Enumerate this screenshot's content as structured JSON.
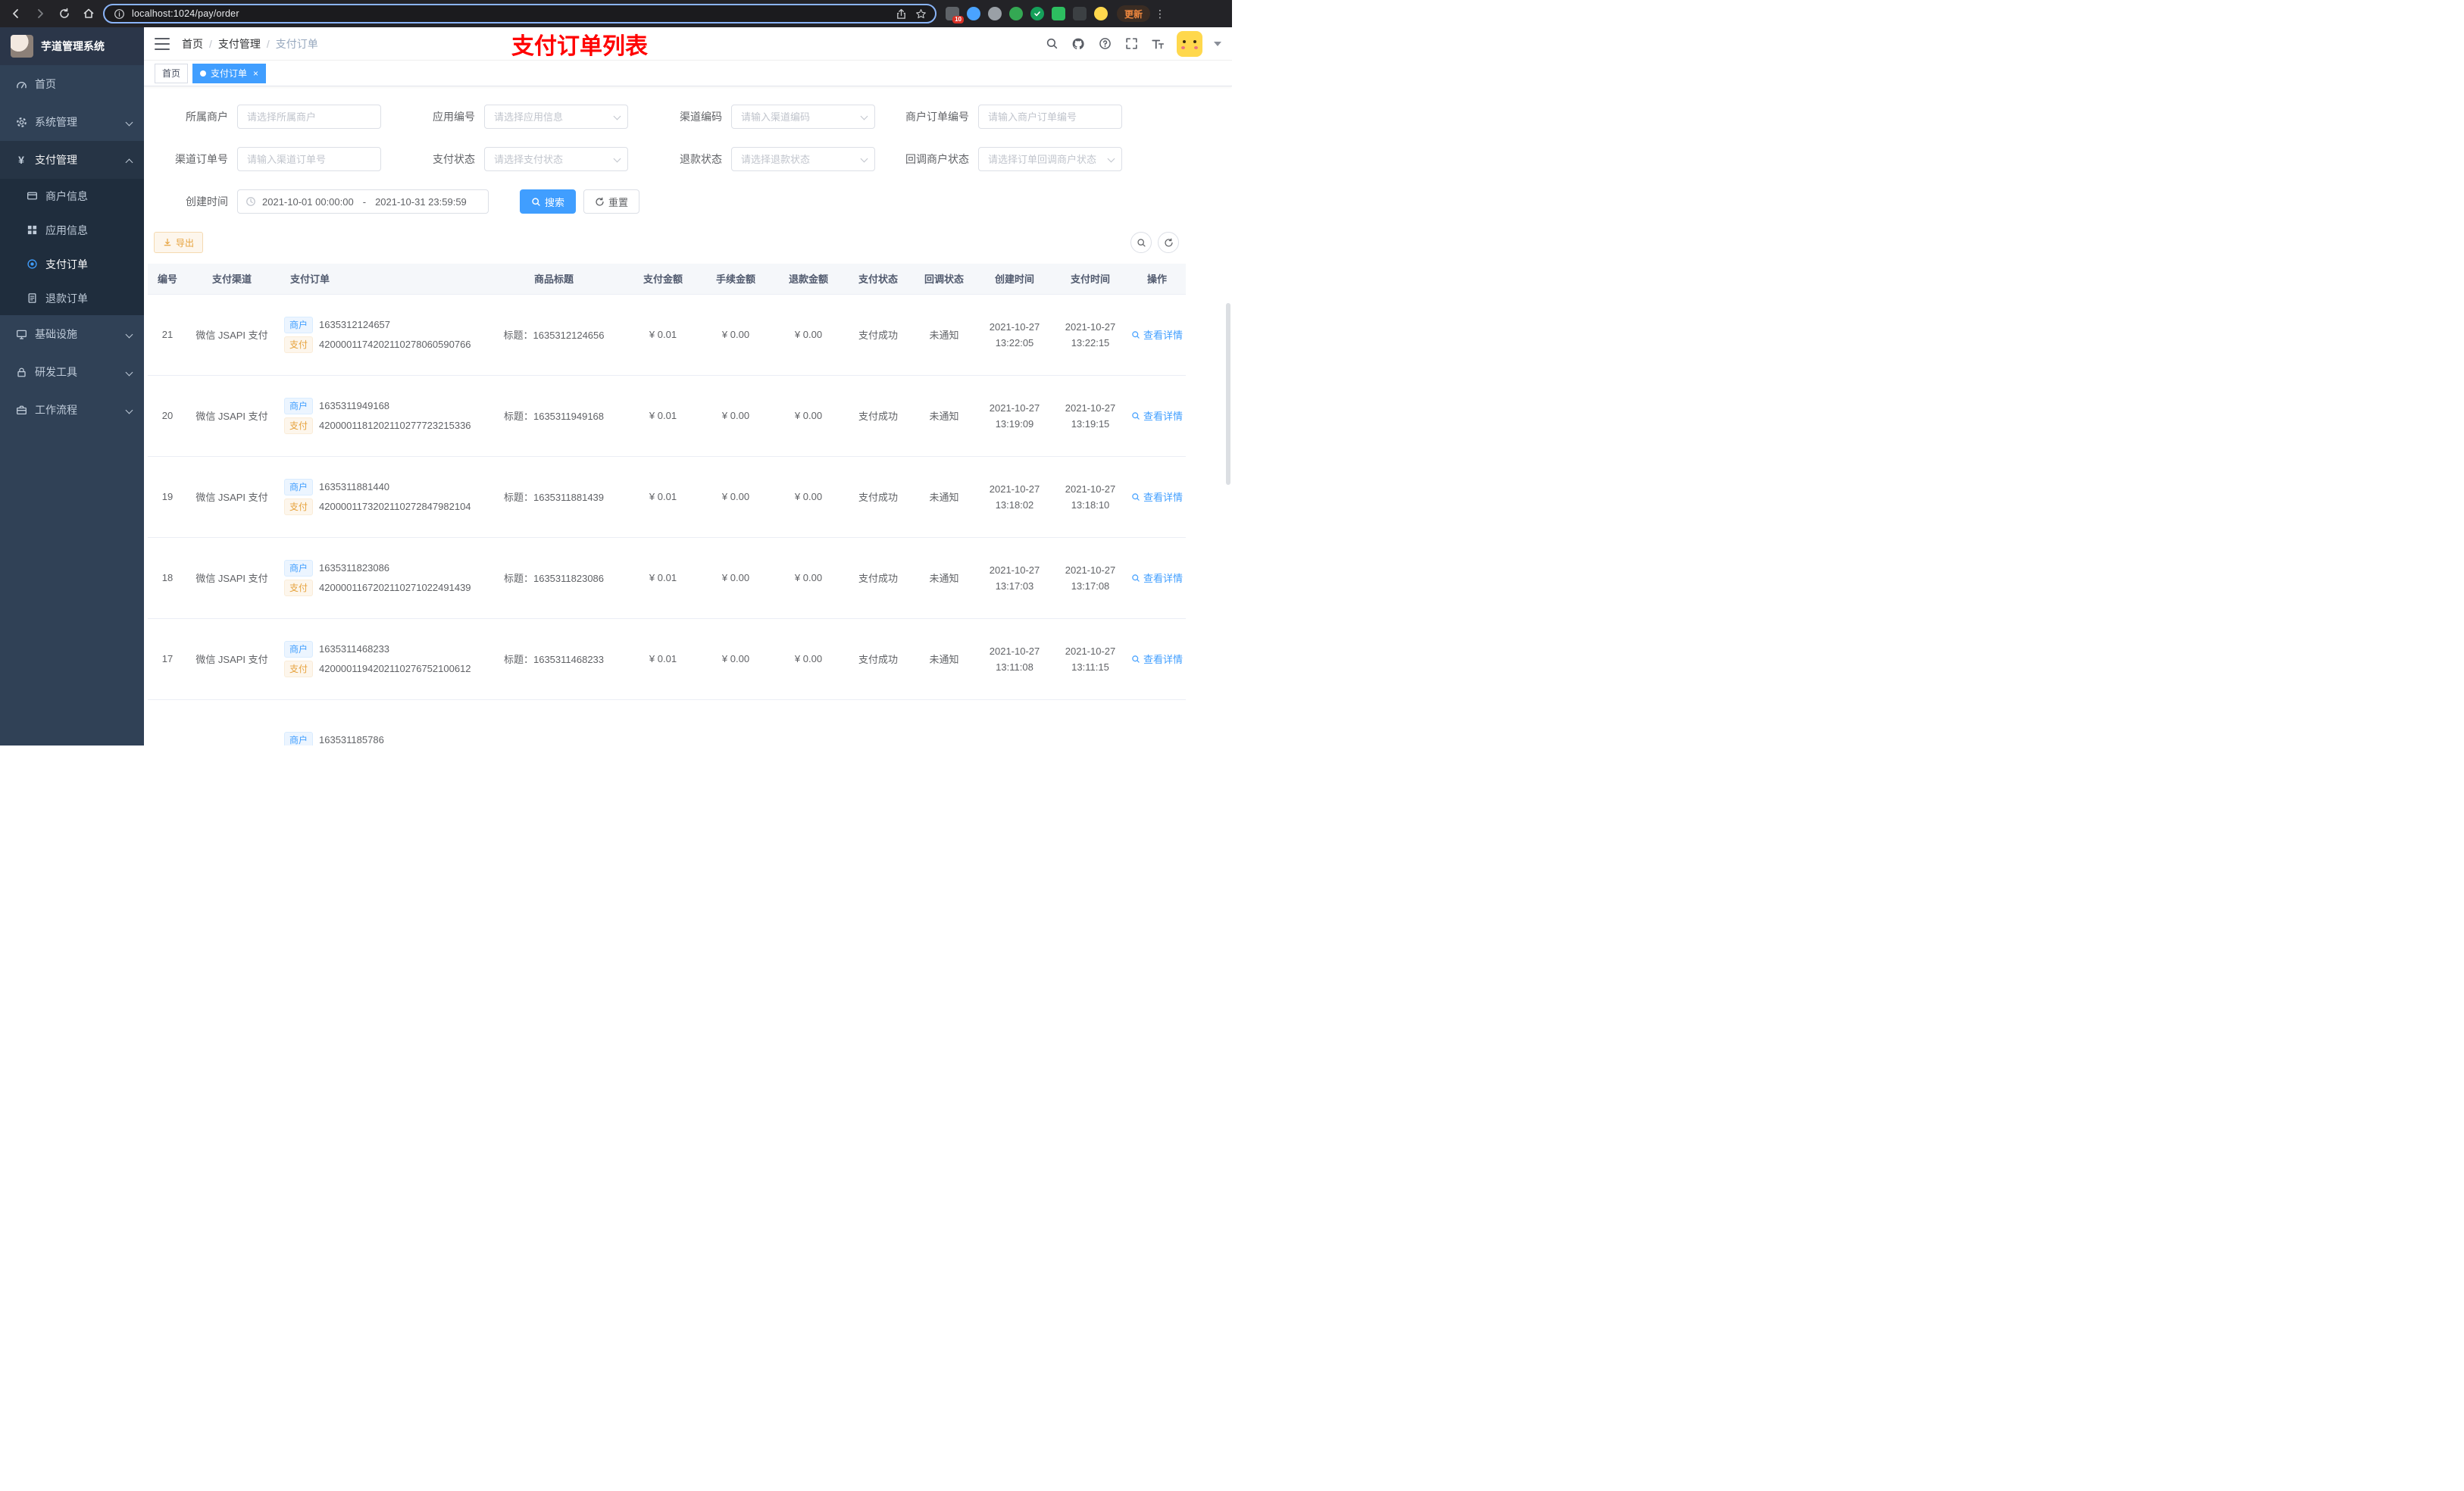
{
  "browser": {
    "url": "localhost:1024/pay/order",
    "update_label": "更新",
    "extension_badge": "10"
  },
  "sidebar": {
    "logo_title": "芋道管理系统",
    "menu": [
      {
        "label": "首页",
        "icon": "dashboard-icon"
      },
      {
        "label": "系统管理",
        "icon": "gear-icon",
        "arrow": "down"
      },
      {
        "label": "支付管理",
        "icon": "yen-icon",
        "arrow": "up",
        "expanded": true,
        "children": [
          {
            "label": "商户信息",
            "icon": "credit-card-icon"
          },
          {
            "label": "应用信息",
            "icon": "grid-icon"
          },
          {
            "label": "支付订单",
            "icon": "target-icon",
            "active": true
          },
          {
            "label": "退款订单",
            "icon": "document-icon"
          }
        ]
      },
      {
        "label": "基础设施",
        "icon": "monitor-icon",
        "arrow": "down"
      },
      {
        "label": "研发工具",
        "icon": "lock-icon",
        "arrow": "down"
      },
      {
        "label": "工作流程",
        "icon": "briefcase-icon",
        "arrow": "down"
      }
    ]
  },
  "header": {
    "breadcrumb": [
      "首页",
      "支付管理",
      "支付订单"
    ],
    "annotation": "支付订单列表"
  },
  "tabs": [
    {
      "label": "首页",
      "active": false
    },
    {
      "label": "支付订单",
      "active": true
    }
  ],
  "filters": {
    "fields": [
      {
        "label": "所属商户",
        "placeholder": "请选择所属商户",
        "type": "input"
      },
      {
        "label": "应用编号",
        "placeholder": "请选择应用信息",
        "type": "select"
      },
      {
        "label": "渠道编码",
        "placeholder": "请输入渠道编码",
        "type": "select"
      },
      {
        "label": "商户订单编号",
        "placeholder": "请输入商户订单编号",
        "type": "input"
      },
      {
        "label": "渠道订单号",
        "placeholder": "请输入渠道订单号",
        "type": "input"
      },
      {
        "label": "支付状态",
        "placeholder": "请选择支付状态",
        "type": "select"
      },
      {
        "label": "退款状态",
        "placeholder": "请选择退款状态",
        "type": "select"
      },
      {
        "label": "回调商户状态",
        "placeholder": "请选择订单回调商户状态",
        "type": "select"
      }
    ],
    "date": {
      "label": "创建时间",
      "start": "2021-10-01 00:00:00",
      "separator": "-",
      "end": "2021-10-31 23:59:59"
    },
    "search_button": "搜索",
    "reset_button": "重置"
  },
  "toolbar": {
    "export_label": "导出"
  },
  "table": {
    "columns": [
      "编号",
      "支付渠道",
      "支付订单",
      "商品标题",
      "支付金额",
      "手续金额",
      "退款金额",
      "支付状态",
      "回调状态",
      "创建时间",
      "支付时间",
      "操作"
    ],
    "tags": {
      "merchant": "商户",
      "pay": "支付"
    },
    "rows": [
      {
        "id": "21",
        "channel": "微信 JSAPI 支付",
        "merchant_no": "1635312124657",
        "pay_no": "4200001174202110278060590766",
        "title": "标题：1635312124656",
        "amount": "¥ 0.01",
        "fee": "¥ 0.00",
        "refund": "¥ 0.00",
        "status": "支付成功",
        "notify": "未通知",
        "create_date": "2021-10-27",
        "create_time": "13:22:05",
        "pay_date": "2021-10-27",
        "pay_time": "13:22:15",
        "action": "查看详情"
      },
      {
        "id": "20",
        "channel": "微信 JSAPI 支付",
        "merchant_no": "1635311949168",
        "pay_no": "4200001181202110277723215336",
        "title": "标题：1635311949168",
        "amount": "¥ 0.01",
        "fee": "¥ 0.00",
        "refund": "¥ 0.00",
        "status": "支付成功",
        "notify": "未通知",
        "create_date": "2021-10-27",
        "create_time": "13:19:09",
        "pay_date": "2021-10-27",
        "pay_time": "13:19:15",
        "action": "查看详情"
      },
      {
        "id": "19",
        "channel": "微信 JSAPI 支付",
        "merchant_no": "1635311881440",
        "pay_no": "4200001173202110272847982104",
        "title": "标题：1635311881439",
        "amount": "¥ 0.01",
        "fee": "¥ 0.00",
        "refund": "¥ 0.00",
        "status": "支付成功",
        "notify": "未通知",
        "create_date": "2021-10-27",
        "create_time": "13:18:02",
        "pay_date": "2021-10-27",
        "pay_time": "13:18:10",
        "action": "查看详情"
      },
      {
        "id": "18",
        "channel": "微信 JSAPI 支付",
        "merchant_no": "1635311823086",
        "pay_no": "4200001167202110271022491439",
        "title": "标题：1635311823086",
        "amount": "¥ 0.01",
        "fee": "¥ 0.00",
        "refund": "¥ 0.00",
        "status": "支付成功",
        "notify": "未通知",
        "create_date": "2021-10-27",
        "create_time": "13:17:03",
        "pay_date": "2021-10-27",
        "pay_time": "13:17:08",
        "action": "查看详情"
      },
      {
        "id": "17",
        "channel": "微信 JSAPI 支付",
        "merchant_no": "1635311468233",
        "pay_no": "4200001194202110276752100612",
        "title": "标题：1635311468233",
        "amount": "¥ 0.01",
        "fee": "¥ 0.00",
        "refund": "¥ 0.00",
        "status": "支付成功",
        "notify": "未通知",
        "create_date": "2021-10-27",
        "create_time": "13:11:08",
        "pay_date": "2021-10-27",
        "pay_time": "13:11:15",
        "action": "查看详情"
      },
      {
        "id": "",
        "channel": "",
        "merchant_no": "163531185786",
        "pay_no": "",
        "title": "",
        "amount": "",
        "fee": "",
        "refund": "",
        "status": "",
        "notify": "",
        "create_date": "",
        "create_time": "",
        "pay_date": "",
        "pay_time": "",
        "action": ""
      }
    ]
  }
}
